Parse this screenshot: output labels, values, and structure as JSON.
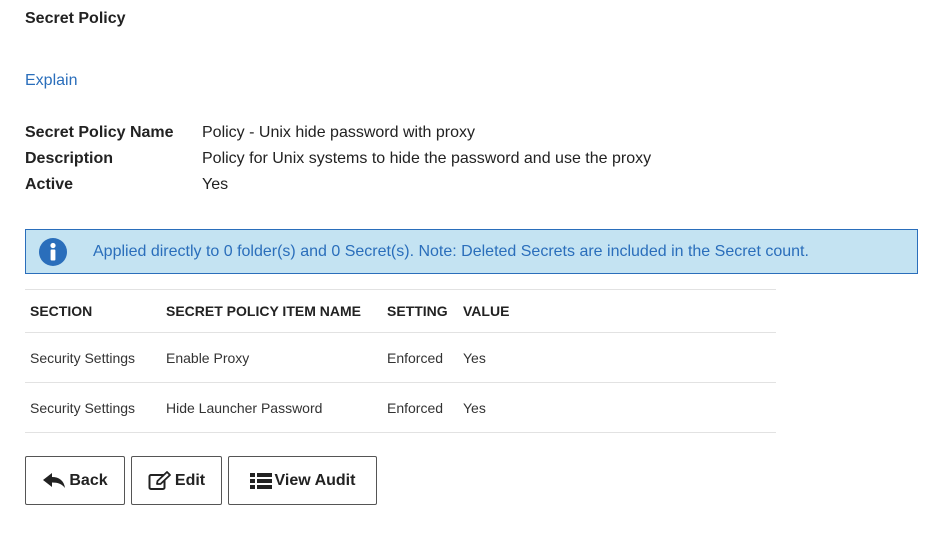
{
  "page": {
    "title": "Secret Policy",
    "explain_link": "Explain"
  },
  "details": [
    {
      "label": "Secret Policy Name",
      "value": "Policy - Unix hide password with proxy"
    },
    {
      "label": "Description",
      "value": "Policy for Unix systems to hide the password and use the proxy"
    },
    {
      "label": "Active",
      "value": "Yes"
    }
  ],
  "info_bar": {
    "icon": "info-icon",
    "text": "Applied directly to 0 folder(s) and 0 Secret(s). Note: Deleted Secrets are included in the Secret count."
  },
  "table": {
    "headers": [
      "SECTION",
      "SECRET POLICY ITEM NAME",
      "SETTING",
      "VALUE"
    ],
    "rows": [
      [
        "Security Settings",
        "Enable Proxy",
        "Enforced",
        "Yes"
      ],
      [
        "Security Settings",
        "Hide Launcher Password",
        "Enforced",
        "Yes"
      ]
    ]
  },
  "buttons": {
    "back": {
      "label": "Back",
      "icon": "reply-arrow-icon"
    },
    "edit": {
      "label": "Edit",
      "icon": "edit-icon"
    },
    "audit": {
      "label": "View Audit",
      "icon": "list-icon"
    }
  },
  "colors": {
    "link": "#2a6ebb",
    "info_background": "#c4e3f2",
    "info_border": "#2a6ebb"
  }
}
